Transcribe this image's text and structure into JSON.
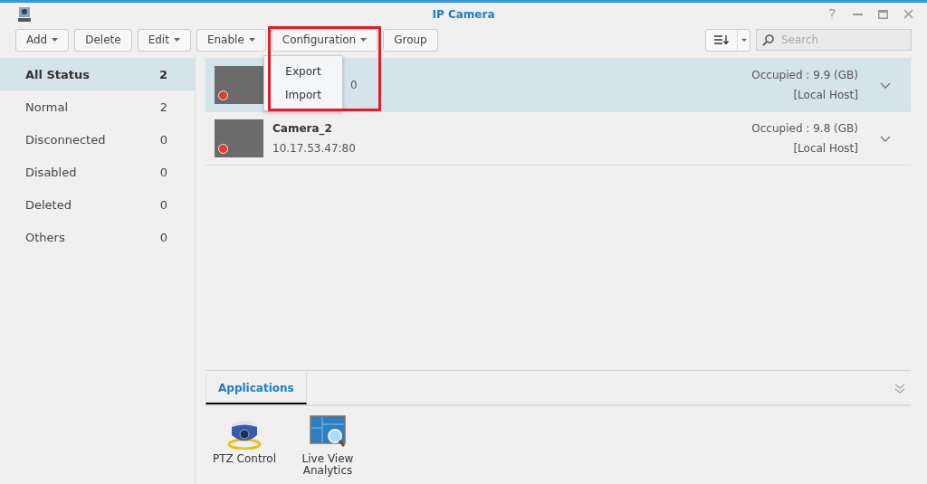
{
  "window": {
    "title": "IP Camera"
  },
  "toolbar": {
    "buttons": [
      {
        "label": "Add",
        "dropdown": true,
        "highlighted": false
      },
      {
        "label": "Delete",
        "dropdown": false,
        "highlighted": false
      },
      {
        "label": "Edit",
        "dropdown": true,
        "highlighted": false
      },
      {
        "label": "Enable",
        "dropdown": true,
        "highlighted": false
      },
      {
        "label": "Configuration",
        "dropdown": true,
        "highlighted": true
      },
      {
        "label": "Group",
        "dropdown": false,
        "highlighted": false
      }
    ],
    "search": {
      "placeholder": "Search"
    }
  },
  "menu": {
    "items": [
      "Export",
      "Import"
    ]
  },
  "sidebar": {
    "items": [
      {
        "label": "All Status",
        "count": "2",
        "selected": true
      },
      {
        "label": "Normal",
        "count": "2",
        "selected": false
      },
      {
        "label": "Disconnected",
        "count": "0",
        "selected": false
      },
      {
        "label": "Disabled",
        "count": "0",
        "selected": false
      },
      {
        "label": "Deleted",
        "count": "0",
        "selected": false
      },
      {
        "label": "Others",
        "count": "0",
        "selected": false
      }
    ]
  },
  "cameras": [
    {
      "address": "0",
      "covered": true,
      "occupied": "Occupied : 9.9 (GB)",
      "host": "[Local Host]",
      "selected": true,
      "recording": true
    },
    {
      "name": "Camera_2",
      "address": "10.17.53.47:80",
      "covered": false,
      "occupied": "Occupied : 9.8 (GB)",
      "host": "[Local Host]",
      "selected": false,
      "recording": true
    }
  ],
  "applications": {
    "tab": "Applications",
    "items": [
      {
        "kind": "ptz",
        "label": "PTZ Control"
      },
      {
        "kind": "analytics",
        "label": "Live View Analytics"
      }
    ]
  }
}
